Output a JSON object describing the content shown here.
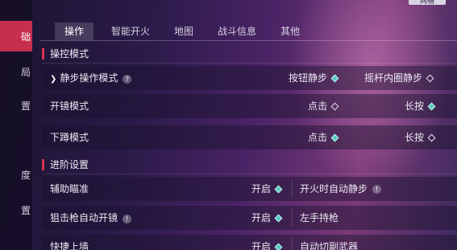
{
  "corner": {
    "label": "网格"
  },
  "sidenav": {
    "items": [
      {
        "label": "础",
        "active": true
      },
      {
        "label": "局",
        "active": false
      },
      {
        "label": "置",
        "active": false
      },
      {
        "label": "",
        "active": false
      },
      {
        "label": "度",
        "active": false
      },
      {
        "label": "置",
        "active": false
      },
      {
        "label": "",
        "active": false
      }
    ]
  },
  "tabs": [
    {
      "label": "操作",
      "active": true
    },
    {
      "label": "智能开火",
      "active": false
    },
    {
      "label": "地图",
      "active": false
    },
    {
      "label": "战斗信息",
      "active": false
    },
    {
      "label": "其他",
      "active": false
    }
  ],
  "sections": {
    "control_mode": "操控模式",
    "advanced": "进阶设置"
  },
  "rows": {
    "silent_step": {
      "label": "静步操作模式",
      "opt_left": "按钮静步",
      "opt_right": "摇杆内圈静步",
      "selected": "left"
    },
    "scope_mode": {
      "label": "开镜模式",
      "opt_left": "点击",
      "opt_right": "长按",
      "selected": "right"
    },
    "crouch_mode": {
      "label": "下蹲模式",
      "opt_left": "点击",
      "opt_right": "长按",
      "selected": "left"
    },
    "aim_assist": {
      "label": "辅助瞄准",
      "value": "开启",
      "right_label": "开火时自动静步"
    },
    "sniper_auto_scope": {
      "label": "狙击枪自动开镜",
      "value": "开启",
      "right_label": "左手持枪"
    },
    "quick_climb": {
      "label": "快捷上墙",
      "value": "开启",
      "right_label": "自动切副武器"
    }
  },
  "colors": {
    "accent": "#c6304e",
    "toggle_on": "#58c8c0"
  }
}
